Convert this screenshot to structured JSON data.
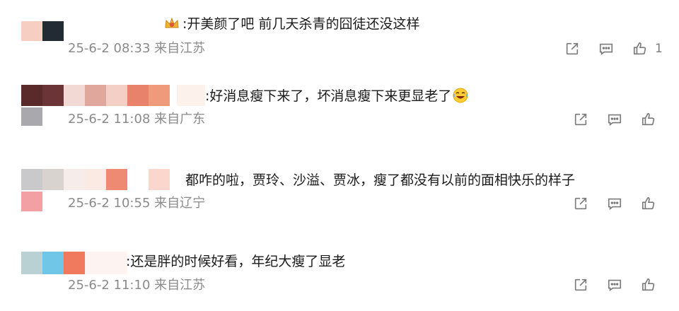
{
  "comments": [
    {
      "text": ":开美颜了吧 前几天杀青的囧徒还没这样",
      "time": "25-6-2 08:33",
      "location": "来自江苏",
      "likes": "1",
      "badge_icon": "crown-badge-icon"
    },
    {
      "text": ":好消息瘦下来了，坏消息瘦下来更显老了",
      "time": "25-6-2 11:08",
      "location": "来自广东",
      "likes": "",
      "emoji_icon": "laughing-emoji-icon"
    },
    {
      "text": "都咋的啦，贾玲、沙溢、贾冰，瘦了都没有以前的面相快乐的样子",
      "time": "25-6-2 10:55",
      "location": "来自辽宁",
      "likes": ""
    },
    {
      "text": ":还是胖的时候好看，年纪大瘦了显老",
      "time": "25-6-2 11:10",
      "location": "来自江苏",
      "likes": ""
    }
  ],
  "icons": {
    "share": "share-icon",
    "comment": "comment-icon",
    "like": "thumbs-up-icon"
  },
  "colors": {
    "text": "#1a1a1a",
    "meta": "#8a8a8a",
    "icon": "#7a7a7a"
  }
}
